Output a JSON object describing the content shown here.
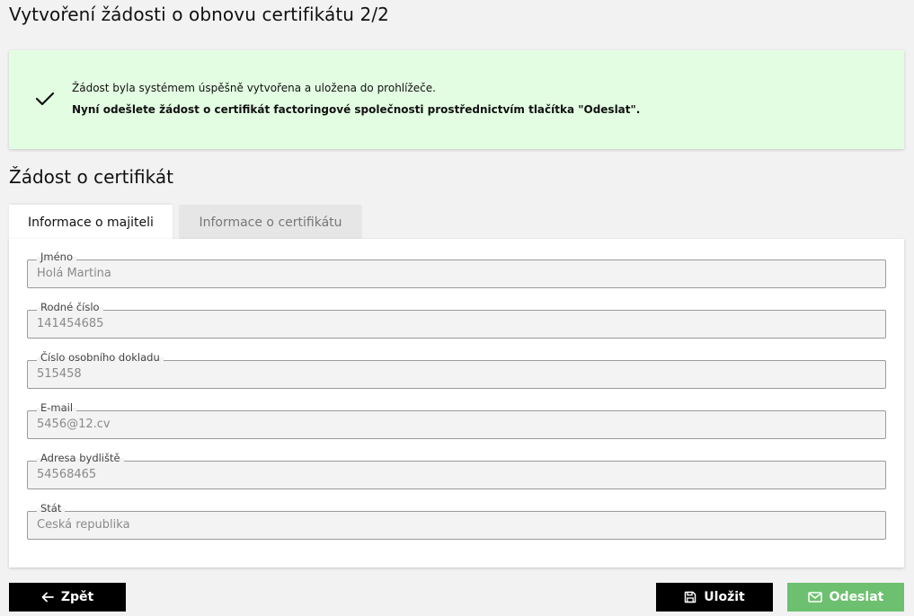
{
  "page": {
    "title": "Vytvoření žádosti o obnovu certifikátu 2/2"
  },
  "alert": {
    "icon": "check-icon",
    "line1": "Žádost byla systémem úspěšně vytvořena a uložena do prohlížeče.",
    "line2": "Nyní odešlete žádost o certifikát factoringové společnosti prostřednictvím tlačítka \"Odeslat\".",
    "background": "#e3fde3"
  },
  "section": {
    "title": "Žádost o certifikát"
  },
  "tabs": [
    {
      "label": "Informace o majiteli",
      "active": true
    },
    {
      "label": "Informace o certifikátu",
      "active": false
    }
  ],
  "fields": [
    {
      "label": "Jméno",
      "value": "Holá Martina"
    },
    {
      "label": "Rodné číslo",
      "value": "141454685"
    },
    {
      "label": "Číslo osobního dokladu",
      "value": "515458"
    },
    {
      "label": "E-mail",
      "value": "5456@12.cv"
    },
    {
      "label": "Adresa bydliště",
      "value": "54568465"
    },
    {
      "label": "Stát",
      "value": "Česká republika"
    }
  ],
  "buttons": {
    "back": {
      "label": "Zpět",
      "icon": "arrow-left-icon"
    },
    "save": {
      "label": "Uložit",
      "icon": "floppy-disk-icon"
    },
    "send": {
      "label": "Odeslat",
      "icon": "envelope-icon",
      "color": "#6dc06f"
    }
  }
}
